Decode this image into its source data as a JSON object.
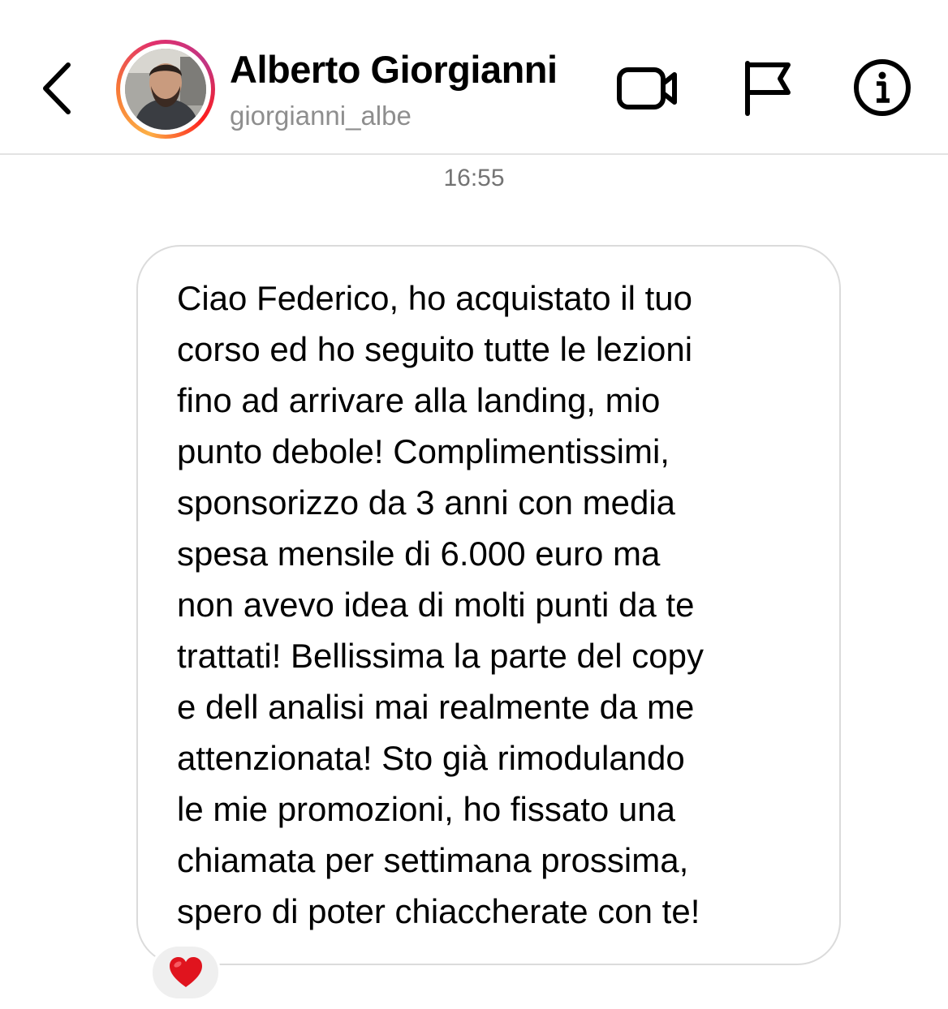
{
  "header": {
    "contact_name": "Alberto Giorgianni",
    "contact_handle": "giorgianni_albe",
    "story_ring_colors": [
      "#fcaf45",
      "#f77737",
      "#e1306c",
      "#c13584"
    ],
    "icons": [
      "back-chevron-icon",
      "video-camera-icon",
      "flag-icon",
      "info-icon"
    ]
  },
  "thread": {
    "timestamp": "16:55",
    "messages": [
      {
        "text": "Ciao Federico, ho acquistato il tuo\ncorso ed ho seguito tutte le lezioni\nfino ad arrivare alla landing, mio\npunto debole! Complimentissimi,\nsponsorizzo da 3 anni con media\nspesa mensile di 6.000 euro ma\nnon avevo idea di molti punti da te\ntrattati! Bellissima la parte del copy\ne dell analisi mai realmente da me\nattenzionata! Sto già rimodulando\nle mie promozioni, ho fissato una\nchiamata per settimana prossima,\nspero di poter chiaccherate con te!",
        "reaction": "red-heart"
      }
    ]
  },
  "colors": {
    "bubble_border": "#dbdbdb",
    "secondary_text": "#8e8e8e",
    "reaction_bg": "#efefef",
    "heart": "#e0141e"
  }
}
